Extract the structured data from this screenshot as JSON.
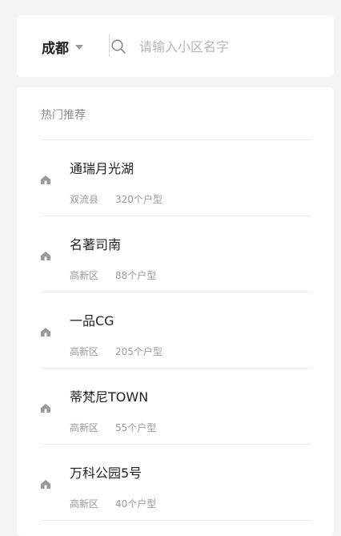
{
  "search": {
    "city": "成都",
    "placeholder": "请输入小区名字",
    "value": ""
  },
  "section_title": "热门推荐",
  "communities": [
    {
      "name": "通瑞月光湖",
      "district": "双流县",
      "count": "320个户型"
    },
    {
      "name": "名著司南",
      "district": "高新区",
      "count": "88个户型"
    },
    {
      "name": "一品CG",
      "district": "高新区",
      "count": "205个户型"
    },
    {
      "name": "蒂梵尼TOWN",
      "district": "高新区",
      "count": "55个户型"
    },
    {
      "name": "万科公园5号",
      "district": "高新区",
      "count": "40个户型"
    }
  ],
  "colors": {
    "background": "#f4f4f4",
    "card": "#ffffff",
    "icon_gray": "#9a9a9a"
  },
  "icons": {
    "city_dropdown": "chevron-down-icon",
    "search": "search-icon",
    "item": "house-icon"
  }
}
